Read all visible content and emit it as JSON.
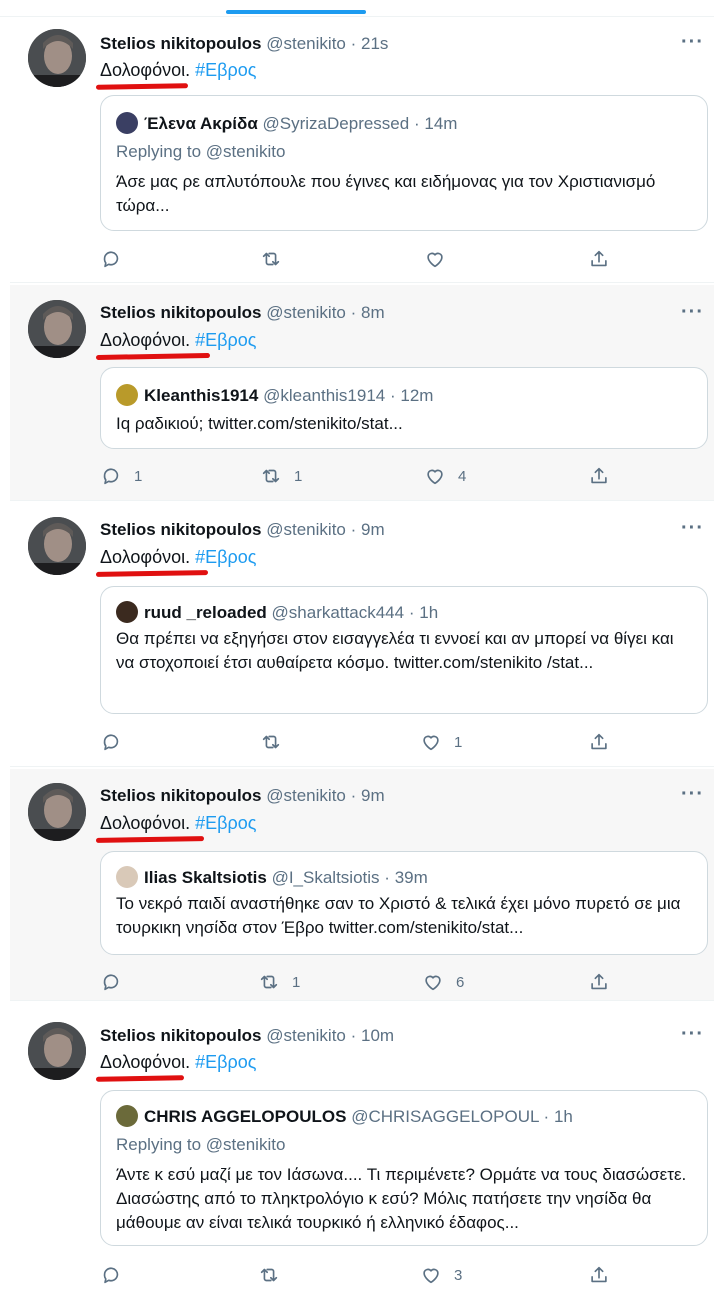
{
  "tweets": [
    {
      "name": "Stelios nikitopoulos",
      "handle": "@stenikito",
      "time": "21s",
      "text": "Δολοφόνοι.",
      "hashtag": "#Εβρος",
      "quote": {
        "name": "Έλενα Ακρίδα",
        "handle": "@SyrizaDepressed",
        "time": "14m",
        "replying": "Replying to @stenikito",
        "body": "Άσε μας ρε απλυτόπουλε που έγινες και ειδήμονας για τον Χριστιανισμό τώρα..."
      },
      "counts": {
        "reply": "",
        "retweet": "",
        "like": ""
      }
    },
    {
      "name": "Stelios nikitopoulos",
      "handle": "@stenikito",
      "time": "8m",
      "text": "Δολοφόνοι.",
      "hashtag": "#Εβρος",
      "quote": {
        "name": "Kleanthis1914",
        "handle": "@kleanthis1914",
        "time": "12m",
        "replying": "",
        "body": "Ιq ραδικιού; twitter.com/stenikito/stat..."
      },
      "counts": {
        "reply": "1",
        "retweet": "1",
        "like": "4"
      }
    },
    {
      "name": "Stelios nikitopoulos",
      "handle": "@stenikito",
      "time": "9m",
      "text": "Δολοφόνοι.",
      "hashtag": "#Εβρος",
      "quote": {
        "name": "ruud _reloaded",
        "handle": "@sharkattack444",
        "time": "1h",
        "replying": "",
        "body": "Θα πρέπει να εξηγήσει στον εισαγγελέα τι εννοεί και αν μπορεί να θίγει και να στοχοποιεί έτσι αυθαίρετα κόσμο. twitter.com/stenikito /stat..."
      },
      "counts": {
        "reply": "",
        "retweet": "",
        "like": "1"
      }
    },
    {
      "name": "Stelios nikitopoulos",
      "handle": "@stenikito",
      "time": "9m",
      "text": "Δολοφόνοι.",
      "hashtag": "#Εβρος",
      "quote": {
        "name": "Ilias Skaltsiotis",
        "handle": "@I_Skaltsiotis",
        "time": "39m",
        "replying": "",
        "body": "Το νεκρό παιδί αναστήθηκε σαν το Χριστό & τελικά έχει μόνο πυρετό σε μια τουρκικη νησίδα στον Έβρο twitter.com/stenikito/stat..."
      },
      "counts": {
        "reply": "",
        "retweet": "1",
        "like": "6"
      }
    },
    {
      "name": "Stelios nikitopoulos",
      "handle": "@stenikito",
      "time": "10m",
      "text": "Δολοφόνοι.",
      "hashtag": "#Εβρος",
      "quote": {
        "name": "CHRIS AGGELOPOULOS",
        "handle": "@CHRISAGGELOPOUL",
        "time": "1h",
        "replying": "Replying to @stenikito",
        "body": "Άντε κ εσύ μαζί με τον Ιάσωνα.... Τι περιμένετε? Ορμάτε να τους διασώσετε. Διασώστης από το πληκτρολόγιο κ εσύ? Μόλις πατήσετε την νησίδα θα μάθουμε αν είναι τελικά τουρκικό ή ελληνικό έδαφος..."
      },
      "counts": {
        "reply": "",
        "retweet": "",
        "like": "3"
      }
    }
  ],
  "separator_dot": "·",
  "more_glyph": "···",
  "colors": {
    "accent": "#1d9bf0",
    "secondary": "#5b7083",
    "highlight_mark": "#e01010"
  },
  "icons": [
    "reply-icon",
    "retweet-icon",
    "like-icon",
    "share-icon",
    "more-icon"
  ]
}
